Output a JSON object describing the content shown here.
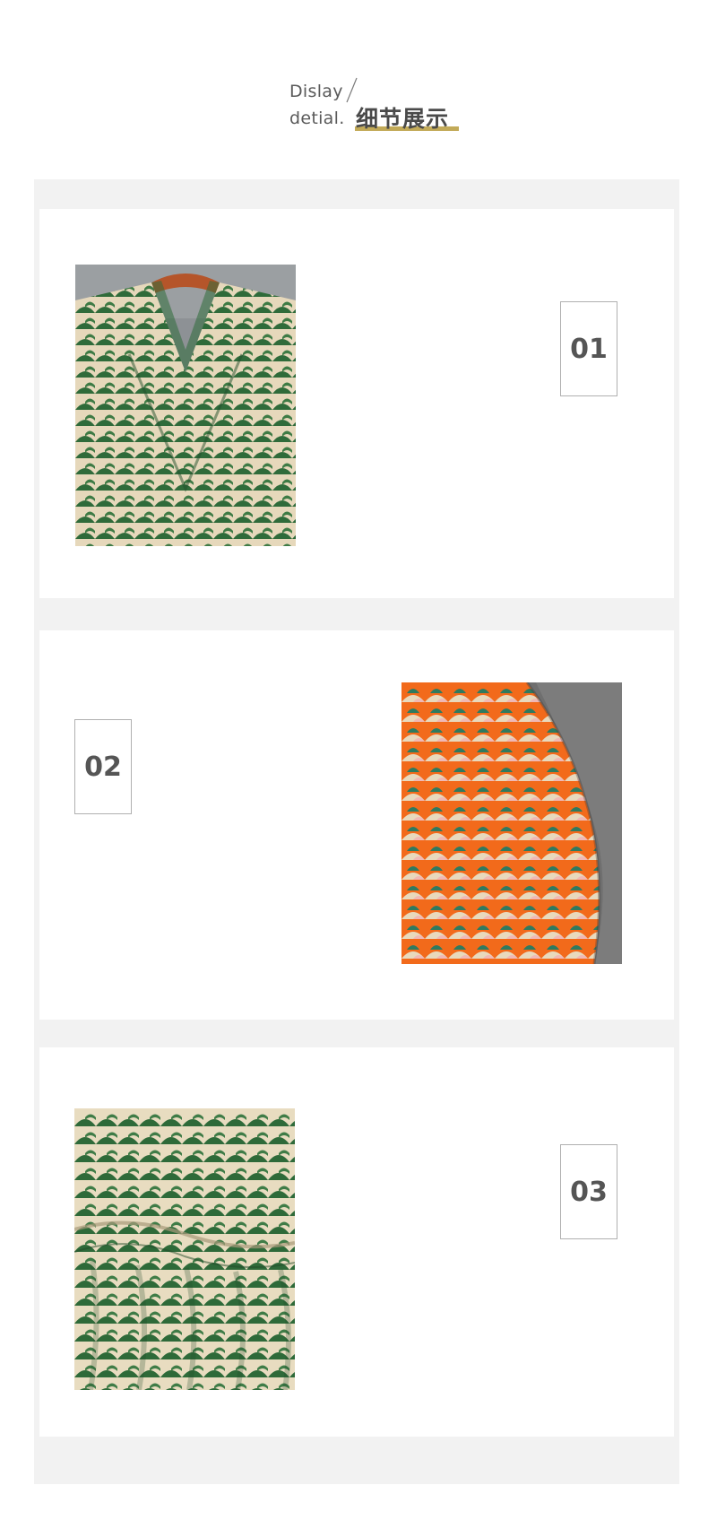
{
  "header": {
    "en_line1": "Dislay",
    "en_line2": "detial.",
    "cn_title": "细节展示"
  },
  "details": [
    {
      "number": "01",
      "pattern": "green-fan-print-neckline"
    },
    {
      "number": "02",
      "pattern": "orange-fan-print-sleeve"
    },
    {
      "number": "03",
      "pattern": "green-fan-print-waist"
    }
  ],
  "colors": {
    "accent": "#b79b3b",
    "panel": "#f2f2f2",
    "text": "#555555",
    "green": "#2f6b3a",
    "cream": "#e8d9bd",
    "orange": "#f26a1b",
    "pink": "#f0b8b5"
  }
}
